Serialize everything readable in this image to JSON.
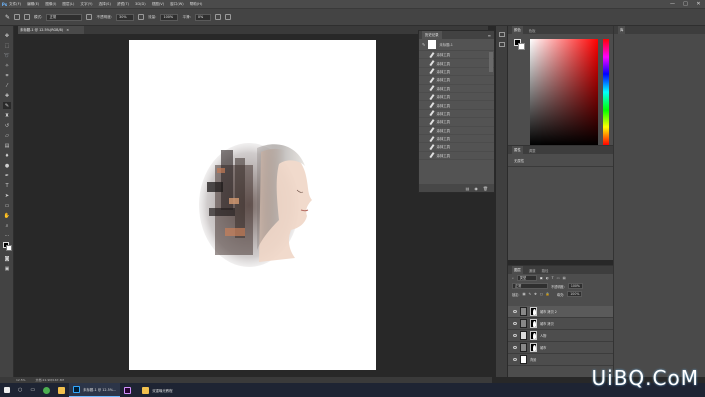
{
  "menubar": {
    "logo": "Ps",
    "items": [
      "文件(F)",
      "编辑(E)",
      "图像(I)",
      "图层(L)",
      "文字(Y)",
      "选择(S)",
      "滤镜(T)",
      "3D(D)",
      "视图(V)",
      "窗口(W)",
      "帮助(H)"
    ],
    "win_min": "—",
    "win_max": "□",
    "win_close": "✕"
  },
  "options": {
    "mode_label": "模式:",
    "mode_value": "正常",
    "opacity_label": "不透明度:",
    "opacity_value": "30%",
    "flow_label": "流量:",
    "flow_value": "100%",
    "smooth_label": "平滑:",
    "smooth_value": "0%"
  },
  "document": {
    "tab_title": "未标题-1 @ 12.5%(RGB/8)",
    "tab_close": "×"
  },
  "status": {
    "zoom": "12.5%",
    "doc_info": "文档:22.9M/167.3M"
  },
  "history": {
    "title": "历史记录",
    "snapshot": "未标题-1",
    "items": [
      "涂抹工具",
      "涂抹工具",
      "涂抹工具",
      "涂抹工具",
      "涂抹工具",
      "涂抹工具",
      "涂抹工具",
      "涂抹工具",
      "涂抹工具",
      "涂抹工具",
      "涂抹工具",
      "涂抹工具",
      "涂抹工具"
    ]
  },
  "color_panel": {
    "tabs": [
      "颜色",
      "色板"
    ]
  },
  "props_panel": {
    "tabs": [
      "属性",
      "调整"
    ],
    "text": "无属性"
  },
  "layers_panel": {
    "tabs": [
      "图层",
      "通道",
      "路径"
    ],
    "kind_label": "类型",
    "blend_value": "正常",
    "opacity_label": "不透明度:",
    "opacity_value": "100%",
    "lock_label": "锁定:",
    "fill_label": "填充:",
    "fill_value": "100%",
    "layers": [
      {
        "name": "城市 拷贝 2"
      },
      {
        "name": "城市 拷贝"
      },
      {
        "name": "人物"
      },
      {
        "name": "城市"
      },
      {
        "name": "背景"
      }
    ]
  },
  "right_col": {
    "tabs": [
      "库"
    ]
  },
  "taskbar": {
    "items": [
      {
        "label": "未标题-1 @ 12.5%..."
      },
      {
        "label": ""
      },
      {
        "label": "双重曝光教程"
      }
    ]
  },
  "watermark": "UiBQ.CoM",
  "colors": {
    "accent": "#2d8ceb",
    "panel_bg": "#535353",
    "canvas_bg": "#282828"
  }
}
